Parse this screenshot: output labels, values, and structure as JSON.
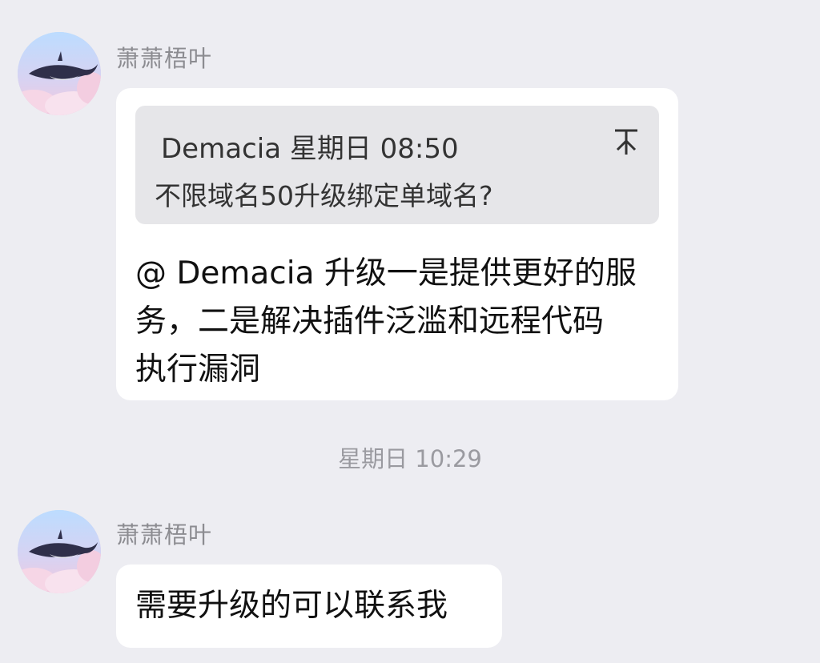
{
  "messages": [
    {
      "sender": "萧萧梧叶",
      "quote": {
        "author_time": "Demacia 星期日 08:50",
        "text": "不限域名50升级绑定单域名?"
      },
      "text_lines": [
        "@ Demacia 升级一是提供更好的服",
        "务，二是解决插件泛滥和远程代码",
        "执行漏洞"
      ]
    },
    {
      "sender": "萧萧梧叶",
      "text_lines": [
        "需要升级的可以联系我"
      ]
    }
  ],
  "timestamp": "星期日 10:29",
  "icons": {
    "avatar": "whale-avatar-icon",
    "pin": "pin-icon"
  }
}
